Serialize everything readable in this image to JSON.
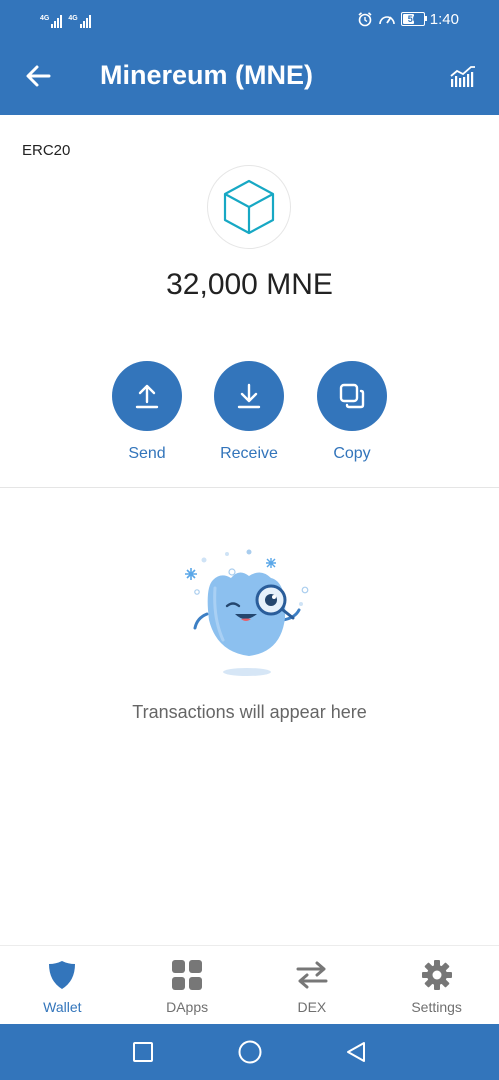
{
  "status_bar": {
    "net_tags": [
      "4G",
      "4G"
    ],
    "battery_level": "50",
    "time": "1:40"
  },
  "header": {
    "title": "Minereum (MNE)",
    "back_icon": "arrow-left-icon",
    "chart_icon": "chart-bars-icon"
  },
  "token": {
    "standard": "ERC20",
    "logo_icon": "cube-icon",
    "balance": "32,000 MNE"
  },
  "actions": [
    {
      "label": "Send",
      "icon": "upload-icon"
    },
    {
      "label": "Receive",
      "icon": "download-icon"
    },
    {
      "label": "Copy",
      "icon": "copy-icon"
    }
  ],
  "empty_state": {
    "message": "Transactions will appear here",
    "illustration": "monocle-mascot-illustration"
  },
  "bottom_nav": {
    "items": [
      {
        "label": "Wallet",
        "icon": "shield-icon",
        "active": true
      },
      {
        "label": "DApps",
        "icon": "grid-icon",
        "active": false
      },
      {
        "label": "DEX",
        "icon": "swap-arrows-icon",
        "active": false
      },
      {
        "label": "Settings",
        "icon": "gear-icon",
        "active": false
      }
    ]
  },
  "colors": {
    "primary": "#3375bb",
    "text": "#222222",
    "muted": "#707070",
    "token_logo": "#17a8c4"
  }
}
